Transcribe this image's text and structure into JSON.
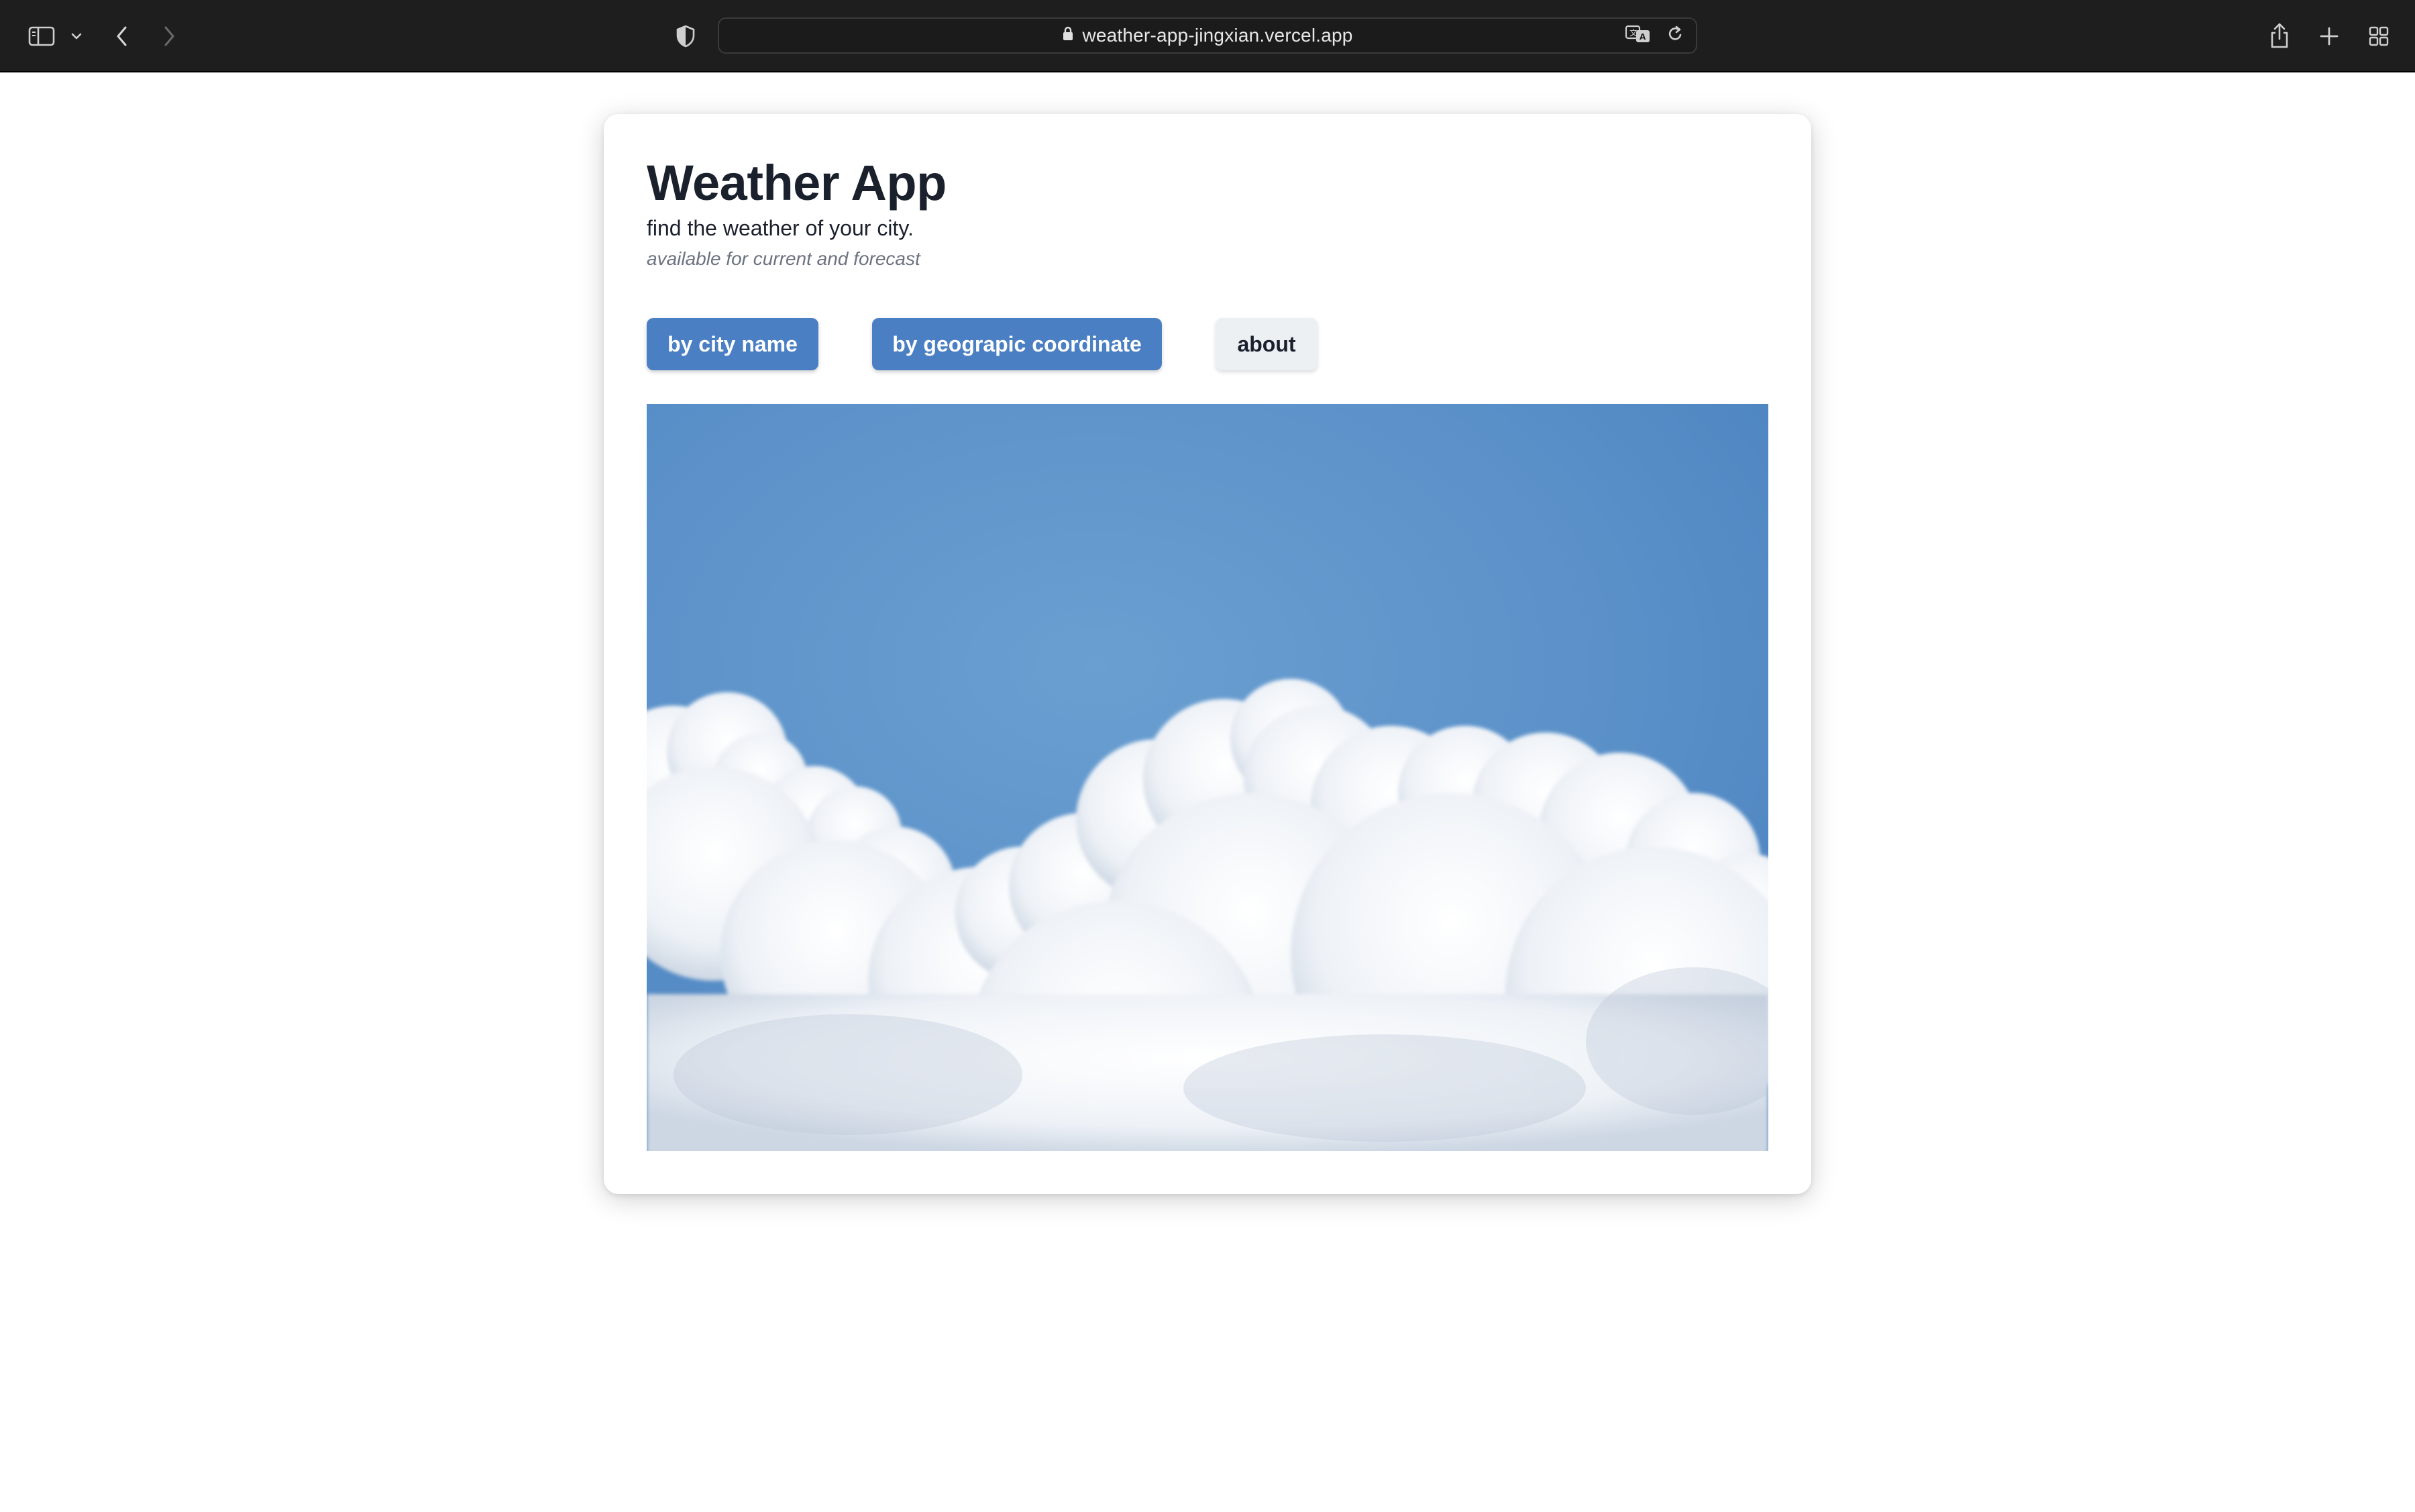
{
  "browser": {
    "url": "weather-app-jingxian.vercel.app",
    "icons": {
      "sidebar": "sidebar-icon",
      "sidebar_menu": "chevron-down-icon",
      "back": "back-arrow-icon",
      "forward": "forward-arrow-icon",
      "privacy": "shield-icon",
      "lock": "lock-icon",
      "translate": "translate-icon",
      "reload": "reload-icon",
      "share": "share-icon",
      "new_tab": "plus-icon",
      "tab_overview": "grid-icon"
    }
  },
  "page": {
    "title": "Weather App",
    "subtitle": "find the weather of your city.",
    "note": "available for current and forecast",
    "buttons": {
      "city": "by city name",
      "coordinate": "by geograpic coordinate",
      "about": "about"
    },
    "hero_image": "clouds-sky-image"
  },
  "colors": {
    "primary_button": "#4a7fc4",
    "light_button": "#edf0f3",
    "toolbar": "#1e1e1e",
    "sky": "#5b93c9"
  }
}
